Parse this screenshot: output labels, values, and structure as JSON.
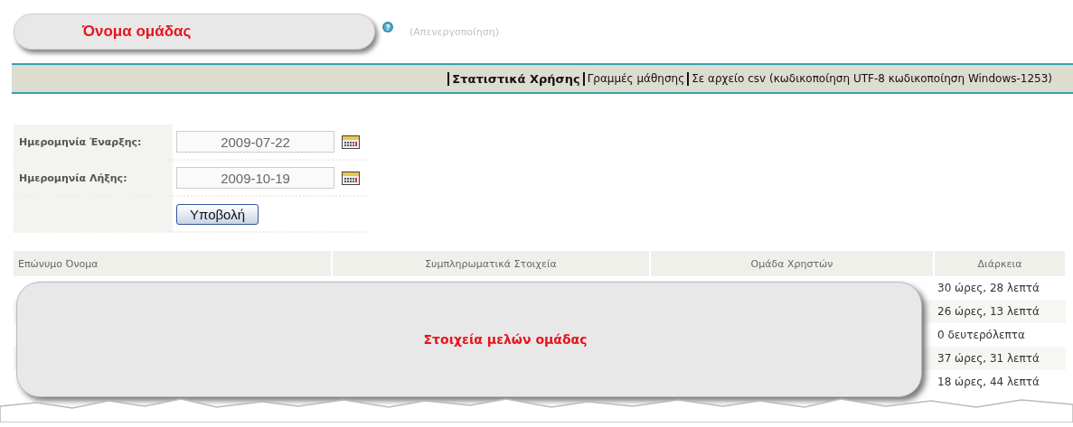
{
  "group_label": "Όνομα ομάδας",
  "disable_link": "(Απενεργοποίηση)",
  "nav": [
    {
      "label": "Στατιστικά Χρήσης",
      "selected": true
    },
    {
      "label": "Γραμμές μάθησης",
      "selected": false
    },
    {
      "label": "Σε αρχείο csv (κωδικοποίηση UTF-8 κωδικοποίηση Windows-1253)",
      "selected": false
    }
  ],
  "form": {
    "start_label": "Ημερομηνία Έναρξης:",
    "start_value": "2009-07-22",
    "end_label": "Ημερομηνία Λήξης:",
    "end_value": "2009-10-19",
    "submit": "Υποβολή"
  },
  "table": {
    "columns": [
      "Επώνυμο Όνομα",
      "Συμπληρωματικά Στοιχεία",
      "Ομάδα Χρηστών",
      "Διάρκεια"
    ],
    "rows": [
      {
        "duration": "30 ώρες, 28 λεπτά"
      },
      {
        "duration": "26 ώρες, 13 λεπτά"
      },
      {
        "duration": "0 δευτερόλεπτα"
      },
      {
        "duration": "37 ώρες, 31 λεπτά"
      },
      {
        "duration": "18 ώρες, 44 λεπτά"
      }
    ]
  },
  "members_label": "Στοιχεία μελών ομάδας"
}
